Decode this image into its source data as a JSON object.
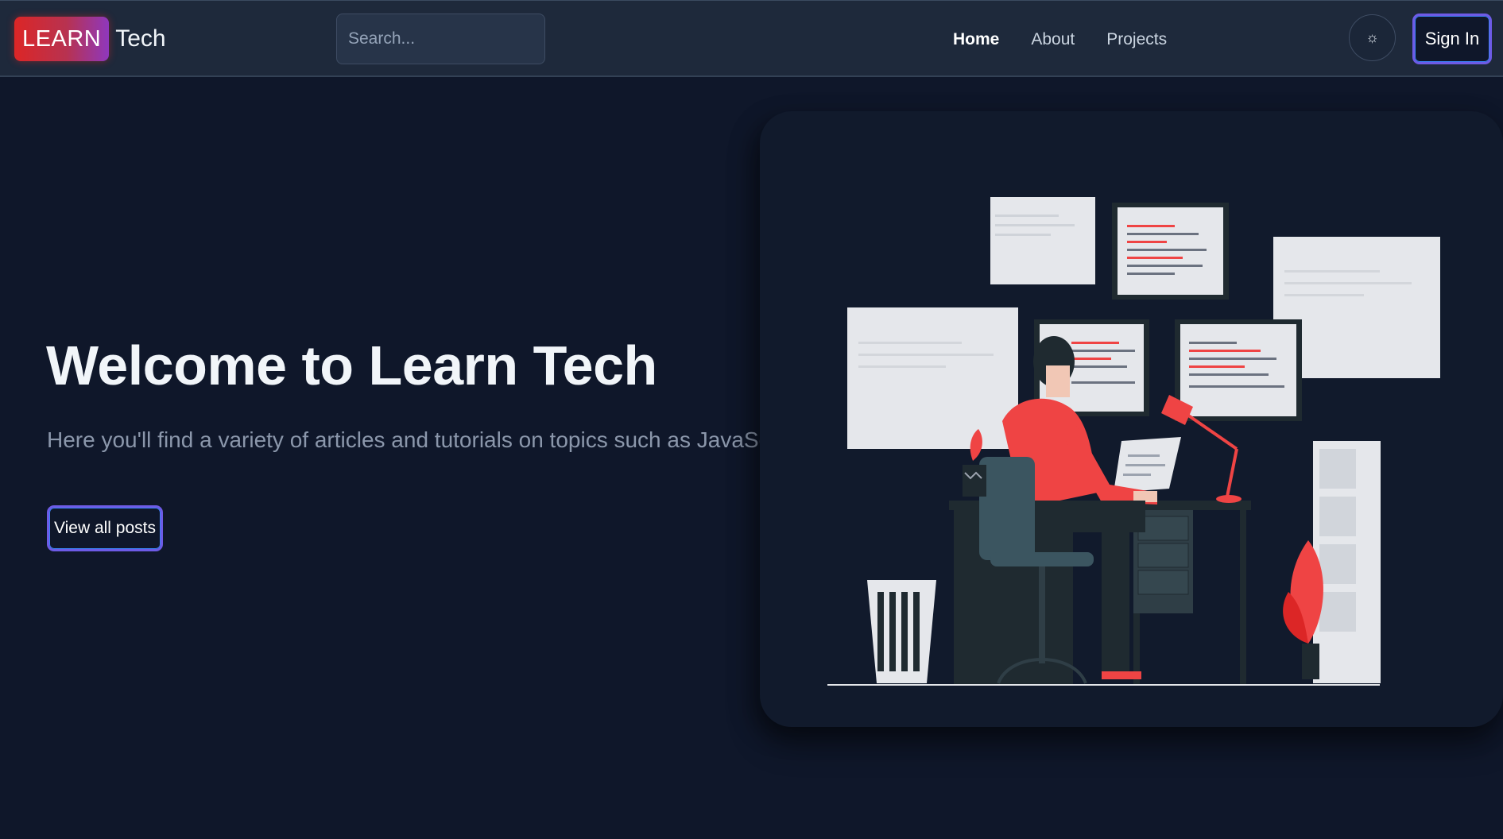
{
  "brand": {
    "learn": "LEARN",
    "tech": "Tech"
  },
  "search": {
    "placeholder": "Search..."
  },
  "nav": {
    "links": [
      {
        "label": "Home",
        "active": true
      },
      {
        "label": "About",
        "active": false
      },
      {
        "label": "Projects",
        "active": false
      }
    ],
    "theme_toggle_icon": "☼",
    "sign_in": "Sign In"
  },
  "hero": {
    "title": "Welcome to Learn Tech",
    "subtitle": "Here you'll find a variety of articles and tutorials on topics such as JavaScript.",
    "caret": "|",
    "cta": "View all posts"
  },
  "colors": {
    "background": "#0f172a",
    "navbar": "#1e293b",
    "accent_red": "#ef4444",
    "accent_gradient": [
      "#dc2626",
      "#7c3aed"
    ],
    "button_border": "#6d5be6"
  },
  "icons": [
    "search-icon",
    "sun-icon"
  ]
}
